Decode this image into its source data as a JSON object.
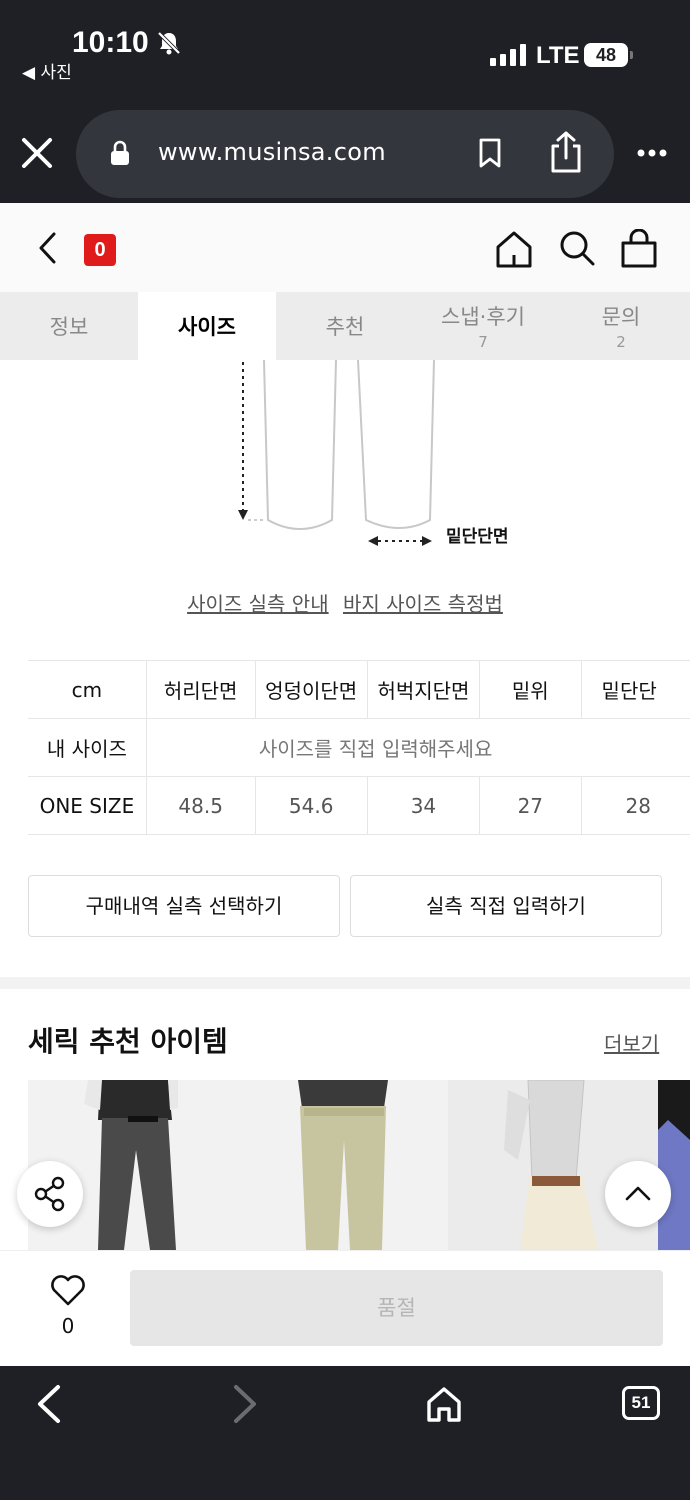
{
  "status_bar": {
    "time": "10:10",
    "back_app": "◀ 사진",
    "network": "LTE",
    "battery": "48"
  },
  "browser": {
    "url": "www.musinsa.com",
    "tab_count": "51"
  },
  "header": {
    "cart_count": "0"
  },
  "tabs": [
    {
      "label": "정보",
      "count": ""
    },
    {
      "label": "사이즈",
      "count": "",
      "active": true
    },
    {
      "label": "추천",
      "count": ""
    },
    {
      "label": "스냅·후기",
      "count": "7"
    },
    {
      "label": "문의",
      "count": "2"
    }
  ],
  "diagram": {
    "hem_label": "밑단단면"
  },
  "guide_links": {
    "size_guide": "사이즈 실측 안내",
    "pants_method": "바지 사이즈 측정법"
  },
  "size_table": {
    "unit": "cm",
    "columns": [
      "허리단면",
      "엉덩이단면",
      "허벅지단면",
      "밑위",
      "밑단단"
    ],
    "my_size_label": "내 사이즈",
    "my_size_prompt": "사이즈를 직접 입력해주세요",
    "rows": [
      {
        "name": "ONE SIZE",
        "values": [
          "48.5",
          "54.6",
          "34",
          "27",
          "28"
        ]
      }
    ]
  },
  "actions": {
    "history": "구매내역 실측 선택하기",
    "manual": "실측 직접 입력하기"
  },
  "recommendations": {
    "title": "세릭 추천 아이템",
    "more": "더보기"
  },
  "buy_bar": {
    "like_count": "0",
    "status": "품절"
  },
  "colors": {
    "accent_red": "#e01b1b",
    "chrome": "#1f2025"
  }
}
